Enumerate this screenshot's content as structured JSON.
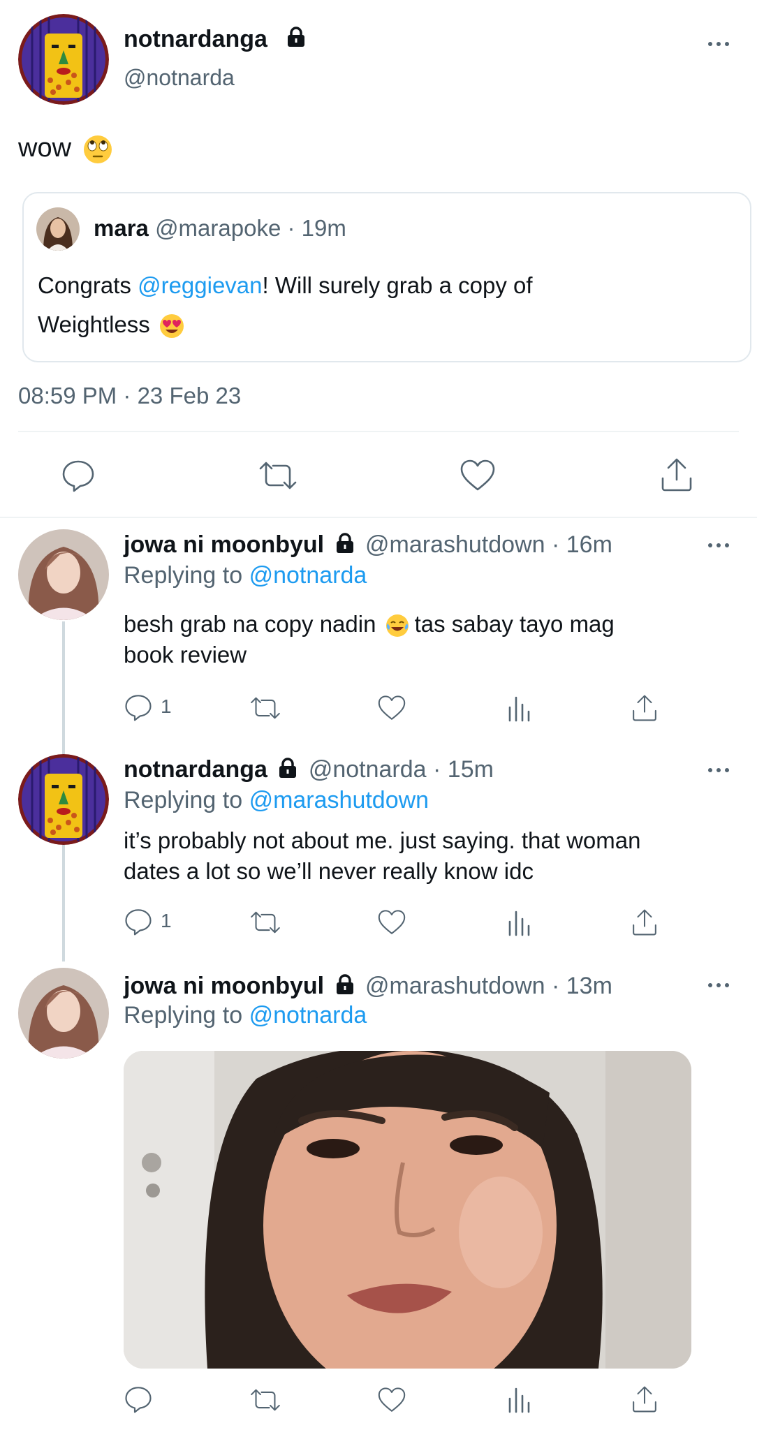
{
  "main_tweet": {
    "display_name": "notnardanga",
    "handle": "@notnarda",
    "text": "wow",
    "emoji_icon": "face-with-rolling-eyes-emoji",
    "timestamp": "08:59 PM · 23 Feb 23",
    "quote": {
      "display_name": "mara",
      "handle": "@marapoke",
      "time": "· 19m",
      "text_before": "Congrats ",
      "mention": "@reggievan",
      "text_after": "! Will surely grab a copy of",
      "text_line2": "Weightless",
      "emoji_icon": "heart-eyes-emoji"
    },
    "actions": [
      "reply-icon",
      "retweet-icon",
      "like-icon",
      "share-icon"
    ]
  },
  "replies": [
    {
      "display_name": "jowa ni moonbyul",
      "handle": "@marashutdown",
      "time": "· 16m",
      "replying_label": "Replying to",
      "replying_to": "@notnarda",
      "text_part1": "besh grab na copy nadin",
      "text_part2": "tas sabay tayo mag",
      "text_line2": "book review",
      "emoji_icon": "tears-of-joy-emoji",
      "reply_count": "1"
    },
    {
      "display_name": "notnardanga",
      "handle": "@notnarda",
      "time": "· 15m",
      "replying_label": "Replying to",
      "replying_to": "@marashutdown",
      "text_line1": "it’s probably not about me. just saying. that woman",
      "text_line2": "dates a lot so we’ll never really know idc",
      "reply_count": "1"
    },
    {
      "display_name": "jowa ni moonbyul",
      "handle": "@marashutdown",
      "time": "· 13m",
      "replying_label": "Replying to",
      "replying_to": "@notnarda",
      "media": "gif-image"
    }
  ],
  "colors": {
    "text": "#0f1419",
    "secondary": "#536471",
    "link": "#1d9bf0",
    "divider": "#eff3f4"
  }
}
